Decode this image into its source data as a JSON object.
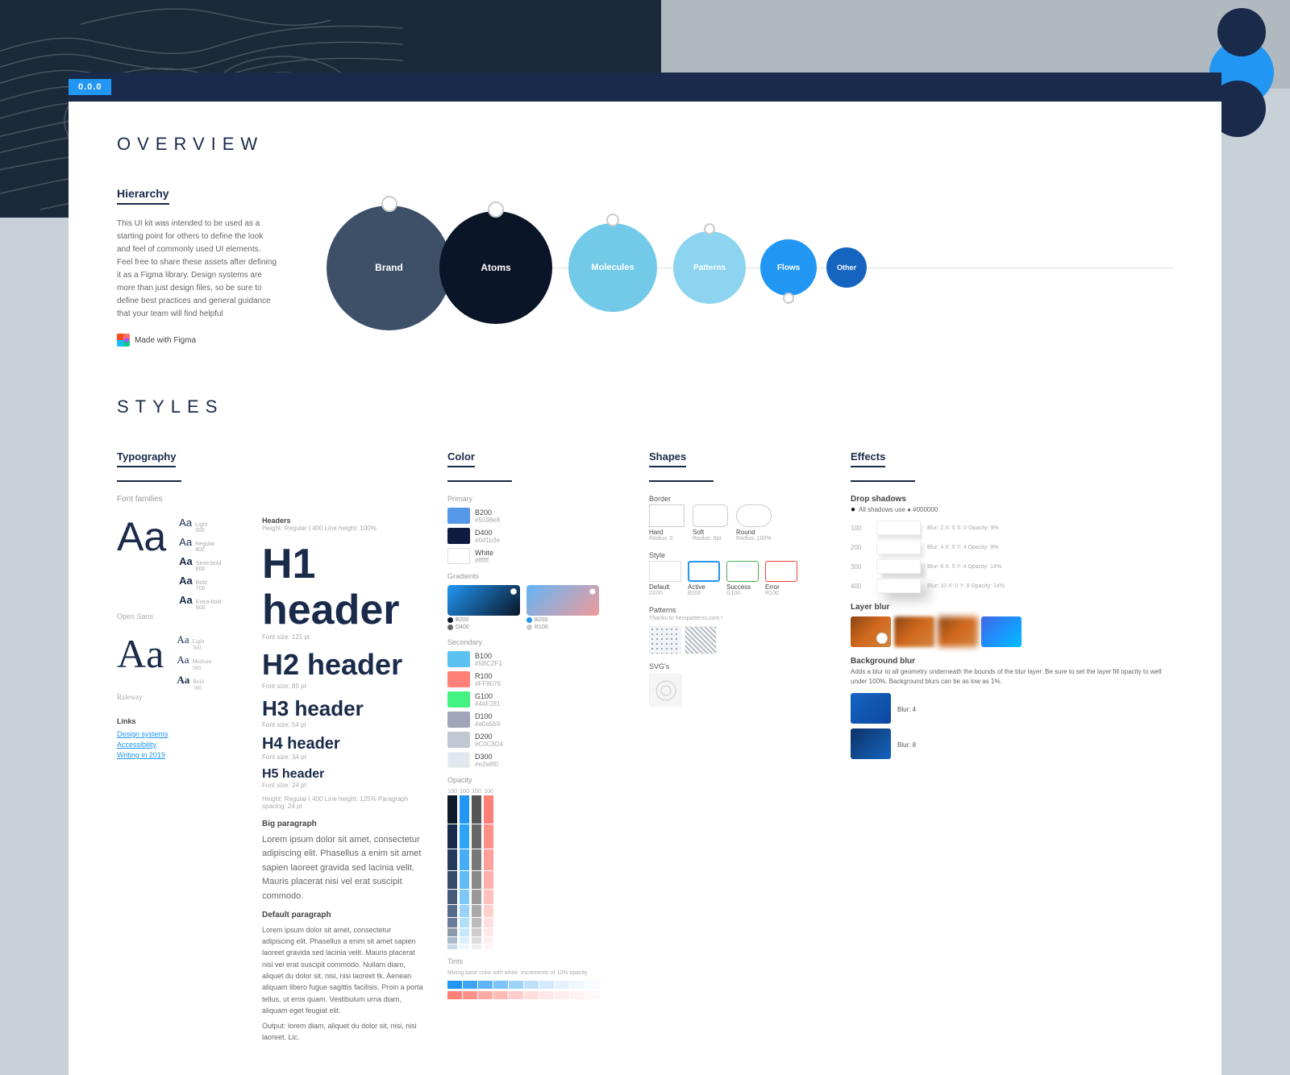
{
  "version": "0.0.0",
  "overview": {
    "title": "OVERVIEW",
    "hierarchy": {
      "label": "Hierarchy",
      "description": "This UI kit was intended to be used as a starting point for others to define the look and feel of commonly used UI elements. Feel free to share these assets after defining it as a Figma library. Design systems are more than just design files, so be sure to define best practices and general guidance that your team will find helpful",
      "made_with_figma": "Made with Figma",
      "bubbles": [
        {
          "id": "brand",
          "label": "Brand",
          "size": 155
        },
        {
          "id": "atoms",
          "label": "Atoms",
          "size": 140
        },
        {
          "id": "molecules",
          "label": "Molecules",
          "size": 110
        },
        {
          "id": "patterns",
          "label": "Patterns",
          "size": 90
        },
        {
          "id": "flows",
          "label": "Flows",
          "size": 70
        },
        {
          "id": "other",
          "label": "Other",
          "size": 50
        }
      ]
    }
  },
  "styles": {
    "title": "STYLES",
    "typography": {
      "label": "Typography",
      "font_families_label": "Font families",
      "fonts": [
        {
          "name": "Open Sans",
          "big_sample": "Aa",
          "variants": [
            "Light 300",
            "Regular 400",
            "Semi-bold 600",
            "Bold 700",
            "Extra-bold 900"
          ]
        },
        {
          "name": "Raleway",
          "big_sample": "Aa",
          "variants": [
            "Light 300",
            "Medium 500",
            "Bold 700"
          ]
        }
      ],
      "headers_label": "Headers",
      "headers_spec": "Height: Regular | 400   Line height: 100%",
      "headers": [
        {
          "tag": "H1 header",
          "spec": "Font size: 121 pt"
        },
        {
          "tag": "H2 header",
          "spec": "Font size: 85 pt"
        },
        {
          "tag": "H3 header",
          "spec": "Font size: 54 pt"
        },
        {
          "tag": "H4 header",
          "spec": "Font size: 34 pt"
        },
        {
          "tag": "H5 header",
          "spec": "Font size: 24 pt"
        }
      ],
      "height_spec": "Height: Regular | 400   Line height: 125%   Paragraph spacing: 24 pt",
      "paragraph_label": "Big paragraph",
      "paragraph_text": "Lorem ipsum dolor sit amet, consectetur adipiscing elit. Phasellus a enim sit amet sapien laoreet gravida sed lacinia velit. Mauris placerat nisi vel erat suscipit commodo.",
      "default_paragraph_label": "Default paragraph",
      "default_paragraph_text": "Lorem ipsum dolor sit amet, consectetur adipiscing elit. Phasellus a enim sit amet sapien laoreet gravida sed lacinia velit. Mauris placerat nisi vel erat suscipit commodo. Nullam diam, aliquet du dolor sit. nisi, nisi laoreet tk. Aenean aliquam libero fugue sagittis facilisis. Proin a porta tellus, ut eros quam. Vestibulum urna diam, aliquam eget feugiat elit.",
      "output_text": "Output: lorem diam, aliquet du dolor sit, nisi, nisi laoreet. Lic.",
      "links": {
        "label": "Links",
        "items": [
          "Design systems",
          "Accessibility",
          "Writing in 2019"
        ]
      }
    },
    "color": {
      "label": "Color",
      "primary_label": "Primary",
      "swatches": [
        {
          "name": "B200",
          "code": "#5598e8",
          "color": "#5598e8"
        },
        {
          "name": "D400",
          "code": "#0d1b3e",
          "color": "#0d1b3e"
        },
        {
          "name": "White",
          "code": "#ffffff",
          "color": "#ffffff",
          "border": true
        }
      ],
      "gradients_label": "Gradients",
      "gradients": [
        {
          "type": "blue_dark",
          "dots": [
            "dark",
            "light"
          ]
        },
        {
          "type": "blue_pink",
          "dots": [
            "blue",
            "light"
          ]
        }
      ],
      "secondary_label": "Secondary",
      "secondary_swatches": [
        {
          "name": "B100",
          "code": "#5BC2F1",
          "color": "#5BC2F1"
        },
        {
          "name": "R100",
          "code": "#FF8076",
          "color": "#FF8076"
        },
        {
          "name": "G100",
          "code": "#44F281",
          "color": "#44F281"
        },
        {
          "name": "D100",
          "code": "#a0a5b9",
          "color": "#a0a5b9"
        },
        {
          "name": "D200",
          "code": "#C0C8D4",
          "color": "#C0C8D4"
        },
        {
          "name": "D300",
          "code": "#e2e8f0",
          "color": "#e2e8f0"
        }
      ],
      "opacity_label": "Opacity",
      "tints_label": "Tints",
      "tints_desc": "Mixing base color with white. Increments of 10% opacity."
    },
    "shapes": {
      "label": "Shapes",
      "border_label": "Border",
      "border_items": [
        {
          "label": "Hard",
          "sublabel": "Radius: 0"
        },
        {
          "label": "Soft",
          "sublabel": "Radius: 8pt"
        },
        {
          "label": "Round",
          "sublabel": "Radius: 100%"
        }
      ],
      "style_label": "Style",
      "style_items": [
        {
          "label": "Default",
          "sublabel": "D200"
        },
        {
          "label": "Active",
          "sublabel": "B200"
        },
        {
          "label": "Success",
          "sublabel": "G100"
        },
        {
          "label": "Error",
          "sublabel": "R100"
        }
      ],
      "patterns_label": "Patterns",
      "patterns_note": "Thanks to heropatterns.com !",
      "svgs_label": "SVG's"
    },
    "effects": {
      "label": "Effects",
      "drop_shadows_label": "Drop shadows",
      "drop_shadows_spec": "All shadows use ● #000000",
      "shadows": [
        {
          "level": "100",
          "spec": "Blur: 2   X: 5   S: 0   Opacity: 9%"
        },
        {
          "level": "200",
          "spec": "Blur: 4   X: 5   Y: 4   Opacity: 9%"
        },
        {
          "level": "300",
          "spec": "Blur: 6   X: 5   Y: 4   Opacity: 14%"
        },
        {
          "level": "400",
          "spec": "Blur: 10   X: 0   Y: 8   Opacity: 24%"
        }
      ],
      "layer_blur_label": "Layer blur",
      "background_blur_label": "Background blur",
      "background_blur_desc": "Adds a blur to all geometry underneath the bounds of the blur layer. Be sure to set the layer fill opacity to well under 100%. Background blurs can be as low as 1%.",
      "blur_levels": [
        {
          "level": "Blur: 4"
        },
        {
          "level": "Blur: 8"
        }
      ]
    }
  }
}
